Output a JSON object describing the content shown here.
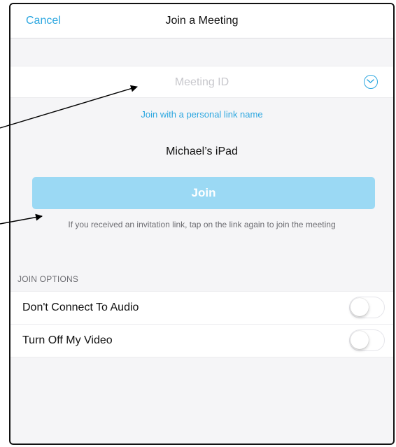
{
  "navbar": {
    "cancel_label": "Cancel",
    "title": "Join a Meeting"
  },
  "meeting_id": {
    "placeholder": "Meeting ID",
    "value": "",
    "dropdown_icon": "chevron-down-circle-icon"
  },
  "personal_link_label": "Join with a personal link name",
  "display_name": "Michael’s iPad",
  "join_button_label": "Join",
  "invite_note": "If you received an invitation link, tap on the link again to join the meeting",
  "join_options": {
    "header": "JOIN OPTIONS",
    "items": [
      {
        "label": "Don't Connect To Audio",
        "enabled": false
      },
      {
        "label": "Turn Off My Video",
        "enabled": false
      }
    ]
  },
  "colors": {
    "accent": "#2da7e0",
    "join_button_disabled": "#9bd9f4",
    "background": "#f5f5f7",
    "annotation_arrow": "#000000"
  }
}
